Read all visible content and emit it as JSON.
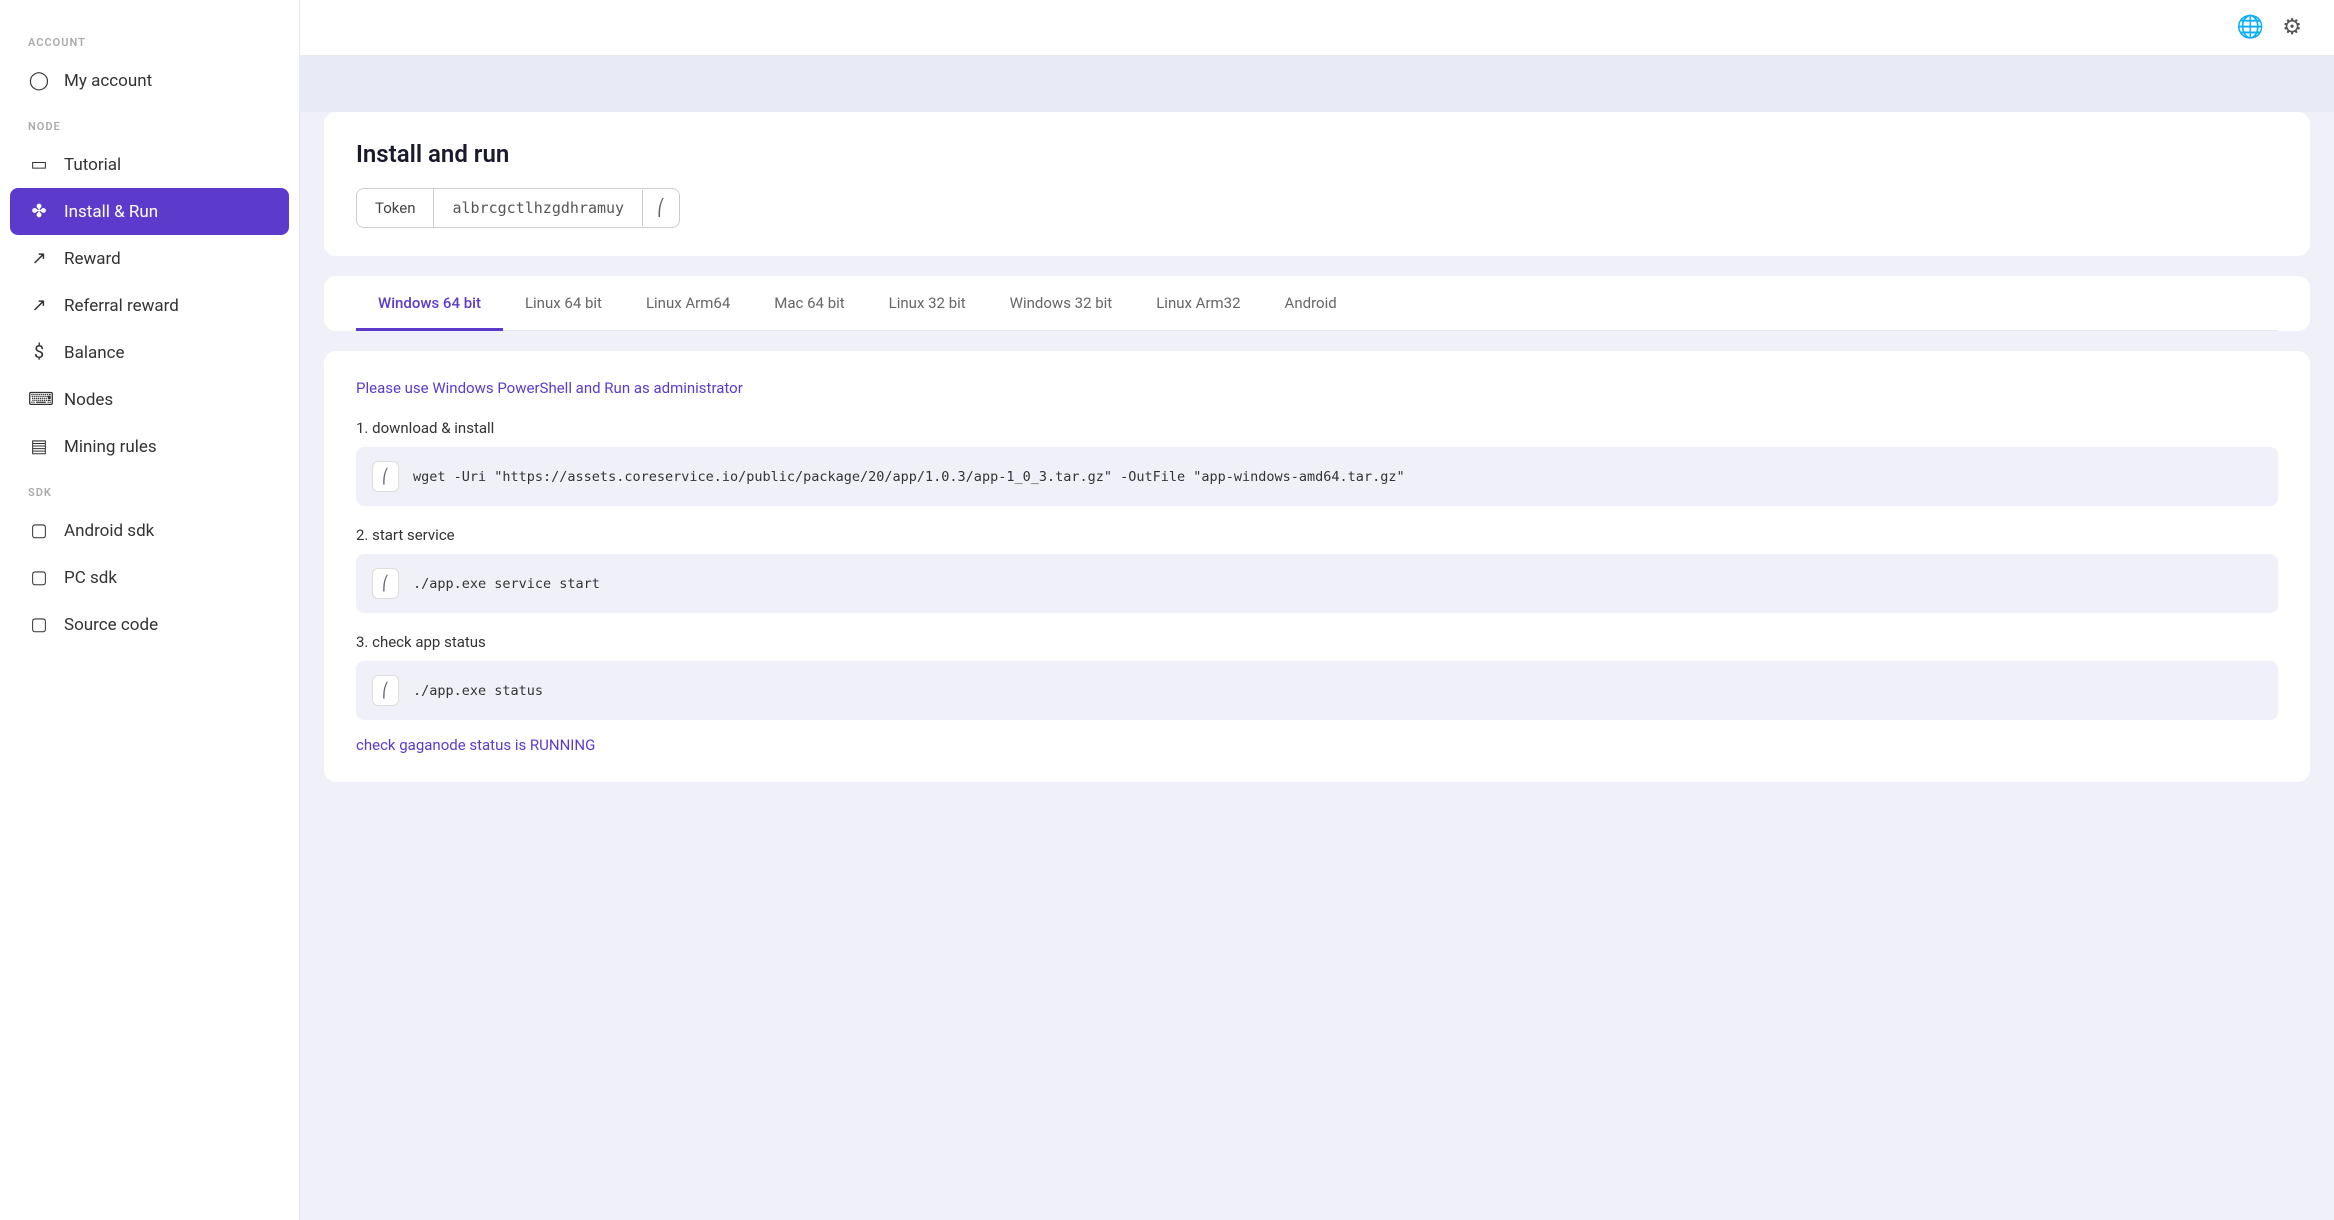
{
  "sidebar": {
    "account_label": "ACCOUNT",
    "node_label": "NODE",
    "sdk_label": "SDK",
    "items": {
      "my_account": "My account",
      "tutorial": "Tutorial",
      "install_run": "Install & Run",
      "reward": "Reward",
      "referral_reward": "Referral reward",
      "balance": "Balance",
      "nodes": "Nodes",
      "mining_rules": "Mining rules",
      "android_sdk": "Android sdk",
      "pc_sdk": "PC sdk",
      "source_code": "Source code"
    }
  },
  "topbar": {
    "globe_icon": "🌐",
    "gear_icon": "⚙"
  },
  "main": {
    "install_card": {
      "title": "Install and run",
      "token_label": "Token",
      "token_value": "albrcgctlhzgdhramuy"
    },
    "tabs": [
      {
        "label": "Windows 64 bit",
        "active": true
      },
      {
        "label": "Linux 64 bit",
        "active": false
      },
      {
        "label": "Linux Arm64",
        "active": false
      },
      {
        "label": "Mac 64 bit",
        "active": false
      },
      {
        "label": "Linux 32 bit",
        "active": false
      },
      {
        "label": "Windows 32 bit",
        "active": false
      },
      {
        "label": "Linux Arm32",
        "active": false
      },
      {
        "label": "Android",
        "active": false
      }
    ],
    "instructions": {
      "admin_notice": "Please use Windows PowerShell and Run as administrator",
      "step1_label": "1. download & install",
      "step1_command": "wget -Uri \"https://assets.coreservice.io/public/package/20/app/1.0.3/app-1_0_3.tar.gz\" -OutFile \"app-windows-amd64.tar.gz\"",
      "step2_label": "2. start service",
      "step2_command": "./app.exe service start",
      "step3_label": "3. check app status",
      "step3_command": "./app.exe status",
      "status_link": "check gaganode status is RUNNING"
    }
  }
}
